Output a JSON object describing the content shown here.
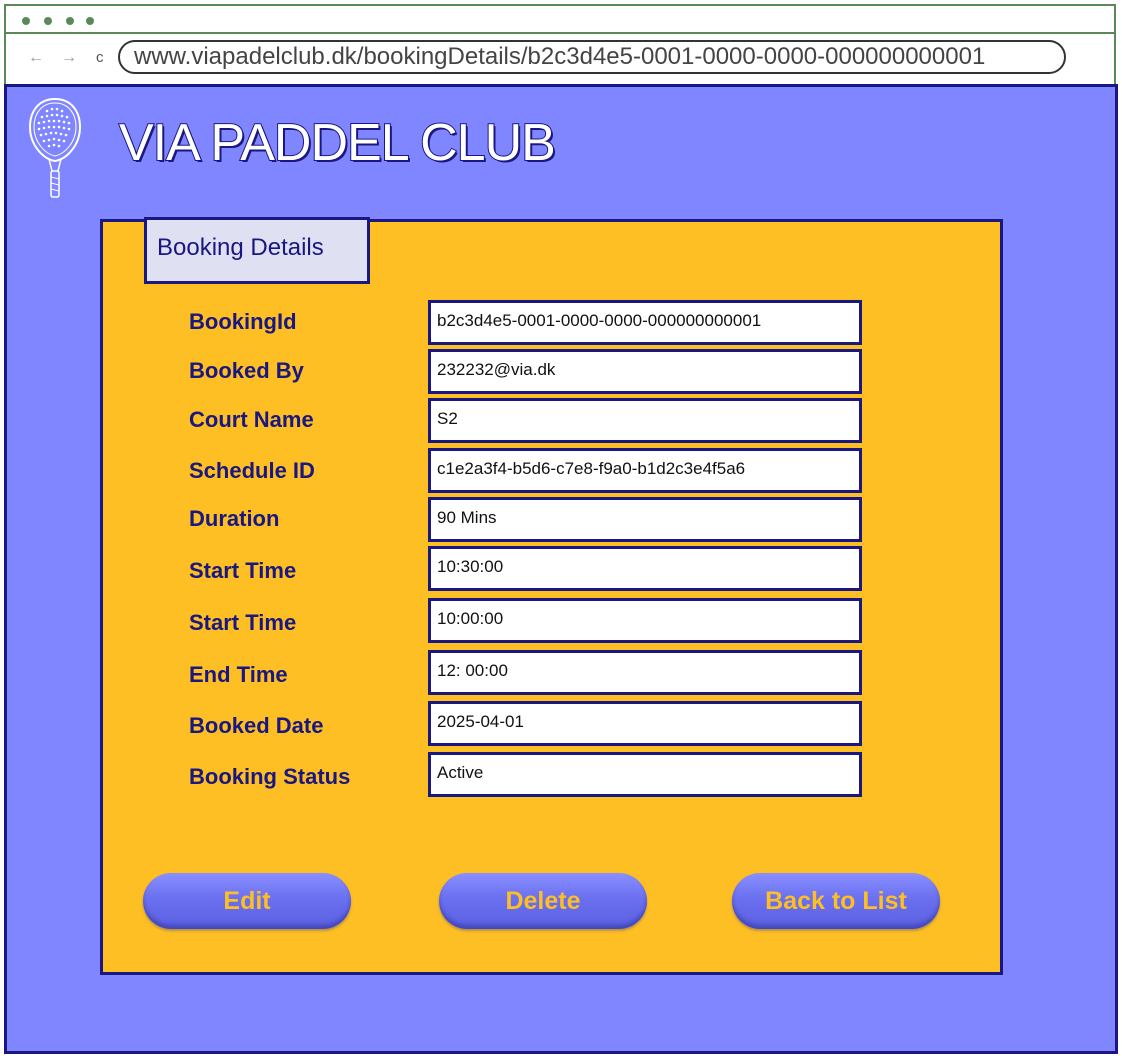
{
  "browser": {
    "nav": {
      "back_icon": "←",
      "forward_icon": "→",
      "reload_icon": "c"
    },
    "url": "www.viapadelclub.dk/bookingDetails/b2c3d4e5-0001-0000-0000-000000000001"
  },
  "header": {
    "title": "VIA PADDEL CLUB",
    "logo_icon": "padel-racket-icon"
  },
  "card": {
    "tab_label": "Booking Details",
    "rows": [
      {
        "label": "BookingId",
        "value": "b2c3d4e5-0001-0000-0000-000000000001"
      },
      {
        "label": "Booked By",
        "value": "232232@via.dk"
      },
      {
        "label": "Court Name",
        "value": "S2"
      },
      {
        "label": "Schedule ID",
        "value": "c1e2a3f4-b5d6-c7e8-f9a0-b1d2c3e4f5a6"
      },
      {
        "label": "Duration",
        "value": "90 Mins"
      },
      {
        "label": "Start Time",
        "value": "10:30:00"
      },
      {
        "label": "Start Time",
        "value": "10:00:00"
      },
      {
        "label": "End Time",
        "value": "12: 00:00"
      },
      {
        "label": "Booked Date",
        "value": "2025-04-01"
      },
      {
        "label": "Booking Status",
        "value": "Active"
      }
    ]
  },
  "actions": {
    "edit_label": "Edit",
    "delete_label": "Delete",
    "back_label": "Back to List"
  },
  "colors": {
    "page_bg": "#7f86ff",
    "card_bg": "#fdbf23",
    "accent_dark": "#1a1780",
    "button_text": "#fdbf23"
  }
}
